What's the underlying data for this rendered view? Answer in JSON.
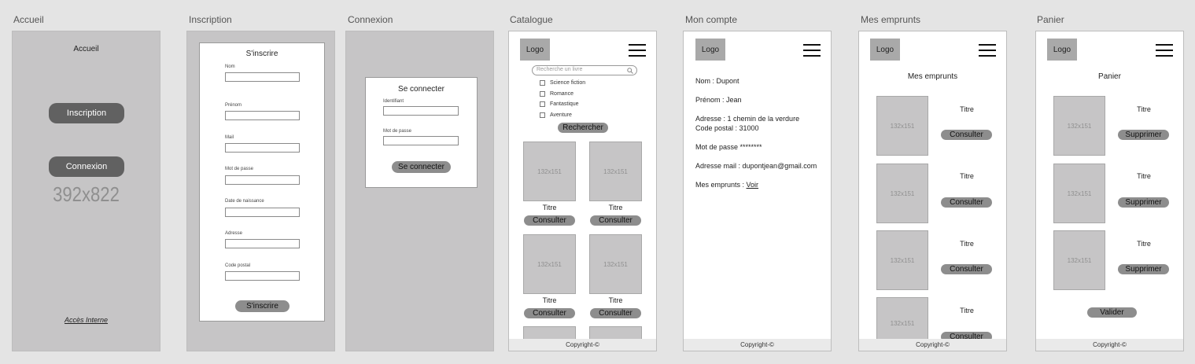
{
  "frames": {
    "accueil": {
      "title": "Accueil",
      "heading": "Accueil",
      "btn_inscription": "Inscription",
      "btn_connexion": "Connexion",
      "size_label": "392x822",
      "acces_interne": "Accès Interne"
    },
    "inscription": {
      "title": "Inscription",
      "heading": "S'inscrire",
      "fields": [
        "Nom",
        "Prénom",
        "Mail",
        "Mot de passe",
        "Date de naissance",
        "Adresse",
        "Code postal"
      ],
      "submit": "S'inscrire"
    },
    "connexion": {
      "title": "Connexion",
      "heading": "Se connecter",
      "fields": [
        "Identifiant",
        "Mot de passe"
      ],
      "submit": "Se connecter"
    },
    "catalogue": {
      "title": "Catalogue",
      "logo": "Logo",
      "search_placeholder": "Recherche un livre",
      "categories": [
        "Science fiction",
        "Romance",
        "Fantastique",
        "Aventure"
      ],
      "search_button": "Rechercher",
      "placeholder_size": "132x151",
      "item_title": "Titre",
      "item_button": "Consulter",
      "footer": "Copyright-©"
    },
    "mon_compte": {
      "title": "Mon compte",
      "logo": "Logo",
      "nom": "Nom : Dupont",
      "prenom": "Prénom : Jean",
      "adresse": "Adresse : 1 chemin de la verdure",
      "code_postal": "Code postal : 31000",
      "mot_de_passe": "Mot de passe ********",
      "mail": "Adresse mail : dupontjean@gmail.com",
      "emprunts_label": "Mes emprunts :",
      "emprunts_link": "Voir",
      "footer": "Copyright-©"
    },
    "mes_emprunts": {
      "title": "Mes emprunts",
      "logo": "Logo",
      "heading": "Mes emprunts",
      "placeholder_size": "132x151",
      "item_title": "Titre",
      "item_button": "Consulter",
      "footer": "Copyright-©"
    },
    "panier": {
      "title": "Panier",
      "logo": "Logo",
      "heading": "Panier",
      "placeholder_size": "132x151",
      "item_title": "Titre",
      "item_button": "Supprimer",
      "validate": "Valider",
      "footer": "Copyright-©"
    }
  }
}
